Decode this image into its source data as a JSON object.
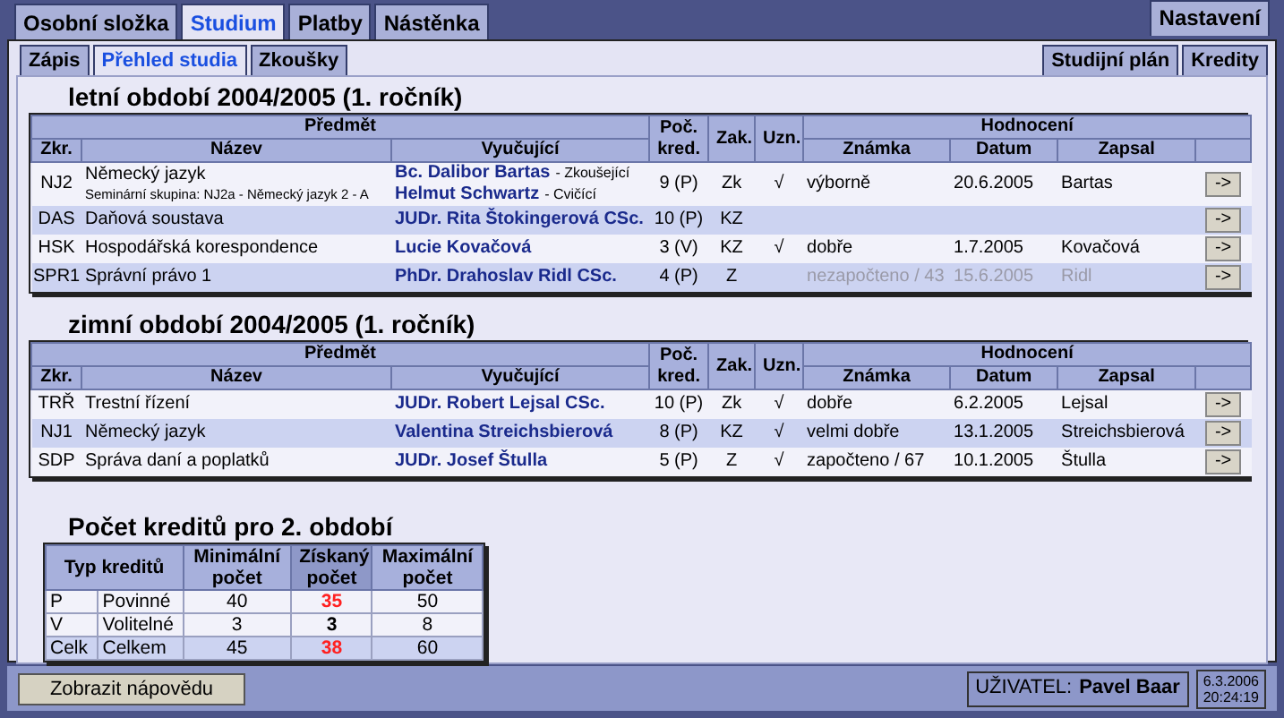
{
  "top_tabs": [
    {
      "label": "Osobní složka",
      "selected": false
    },
    {
      "label": "Studium",
      "selected": true
    },
    {
      "label": "Platby",
      "selected": false
    },
    {
      "label": "Nástěnka",
      "selected": false
    }
  ],
  "settings_tab": {
    "label": "Nastavení",
    "selected": false
  },
  "sub_tabs": [
    {
      "label": "Zápis",
      "selected": false
    },
    {
      "label": "Přehled studia",
      "selected": true
    },
    {
      "label": "Zkoušky",
      "selected": false
    }
  ],
  "sub_buttons": [
    "Studijní plán",
    "Kredity"
  ],
  "semesters": [
    {
      "title": "letní období 2004/2005 (1. ročník)",
      "headers": {
        "subject": "Předmět",
        "code": "Zkr.",
        "name": "Název",
        "teacher": "Vyučující",
        "credits": "Poč. kred.",
        "completion": "Zak.",
        "recognized": "Uzn.",
        "evaluation": "Hodnocení",
        "grade": "Známka",
        "date": "Datum",
        "recorded_by": "Zapsal"
      },
      "rows": [
        {
          "code": "NJ2",
          "name": "Německý jazyk",
          "group": "Seminární skupina: NJ2a - Německý jazyk 2 - A",
          "teachers": [
            {
              "name": "Bc. Dalibor Bartas",
              "role": "- Zkoušející"
            },
            {
              "name": "Helmut Schwartz",
              "role": "- Cvičící"
            }
          ],
          "credits": "9 (P)",
          "completion": "Zk",
          "recognized": "√",
          "grade": "výborně",
          "date": "20.6.2005",
          "recorded_by": "Bartas",
          "greyed": false,
          "button": "->"
        },
        {
          "code": "DAS",
          "name": "Daňová soustava",
          "teachers": [
            {
              "name": "JUDr. Rita Štokingerová CSc."
            }
          ],
          "credits": "10 (P)",
          "completion": "KZ",
          "button": "->"
        },
        {
          "code": "HSK",
          "name": "Hospodářská korespondence",
          "teachers": [
            {
              "name": "Lucie Kovačová"
            }
          ],
          "credits": "3 (V)",
          "completion": "KZ",
          "recognized": "√",
          "grade": "dobře",
          "date": "1.7.2005",
          "recorded_by": "Kovačová",
          "greyed": false,
          "button": "->"
        },
        {
          "code": "SPR1",
          "name": "Správní právo 1",
          "teachers": [
            {
              "name": "PhDr. Drahoslav Ridl CSc."
            }
          ],
          "credits": "4 (P)",
          "completion": "Z",
          "grade": "nezapočteno / 43",
          "date": "15.6.2005",
          "recorded_by": "Ridl",
          "greyed": true,
          "button": "->"
        }
      ]
    },
    {
      "title": "zimní období 2004/2005 (1. ročník)",
      "headers": {
        "subject": "Předmět",
        "code": "Zkr.",
        "name": "Název",
        "teacher": "Vyučující",
        "credits": "Poč. kred.",
        "completion": "Zak.",
        "recognized": "Uzn.",
        "evaluation": "Hodnocení",
        "grade": "Známka",
        "date": "Datum",
        "recorded_by": "Zapsal"
      },
      "rows": [
        {
          "code": "TRŘ",
          "name": "Trestní řízení",
          "teachers": [
            {
              "name": "JUDr. Robert Lejsal CSc."
            }
          ],
          "credits": "10 (P)",
          "completion": "Zk",
          "recognized": "√",
          "grade": "dobře",
          "date": "6.2.2005",
          "recorded_by": "Lejsal",
          "greyed": false,
          "button": "->"
        },
        {
          "code": "NJ1",
          "name": "Německý jazyk",
          "teachers": [
            {
              "name": "Valentina Streichsbierová"
            }
          ],
          "credits": "8 (P)",
          "completion": "KZ",
          "recognized": "√",
          "grade": "velmi dobře",
          "date": "13.1.2005",
          "recorded_by": "Streichsbierová",
          "greyed": false,
          "button": "->"
        },
        {
          "code": "SDP",
          "name": "Správa daní a poplatků",
          "teachers": [
            {
              "name": "JUDr. Josef Štulla"
            }
          ],
          "credits": "5 (P)",
          "completion": "Z",
          "recognized": "√",
          "grade": "započteno / 67",
          "date": "10.1.2005",
          "recorded_by": "Štulla",
          "greyed": false,
          "button": "->"
        }
      ]
    }
  ],
  "credits_summary": {
    "title": "Počet kreditů pro 2. období",
    "headers": {
      "type": "Typ kreditů",
      "min": "Minimální počet",
      "earned": "Získaný počet",
      "max": "Maximální počet"
    },
    "rows": [
      {
        "kind": "normal",
        "code": "P",
        "type": "Povinné",
        "min": "40",
        "earned": "35",
        "earned_met": false,
        "max": "50"
      },
      {
        "kind": "normal",
        "code": "V",
        "type": "Volitelné",
        "min": "3",
        "earned": "3",
        "earned_met": true,
        "max": "8"
      },
      {
        "kind": "total",
        "code": "Celk",
        "type": "Celkem",
        "min": "45",
        "earned": "38",
        "earned_met": false,
        "max": "60"
      }
    ]
  },
  "status_bar": {
    "help_button": "Zobrazit nápovědu",
    "user_label": "UŽIVATEL:",
    "user_name": "Pavel Baar",
    "date": "6.3.2006",
    "time": "20:24:19"
  }
}
